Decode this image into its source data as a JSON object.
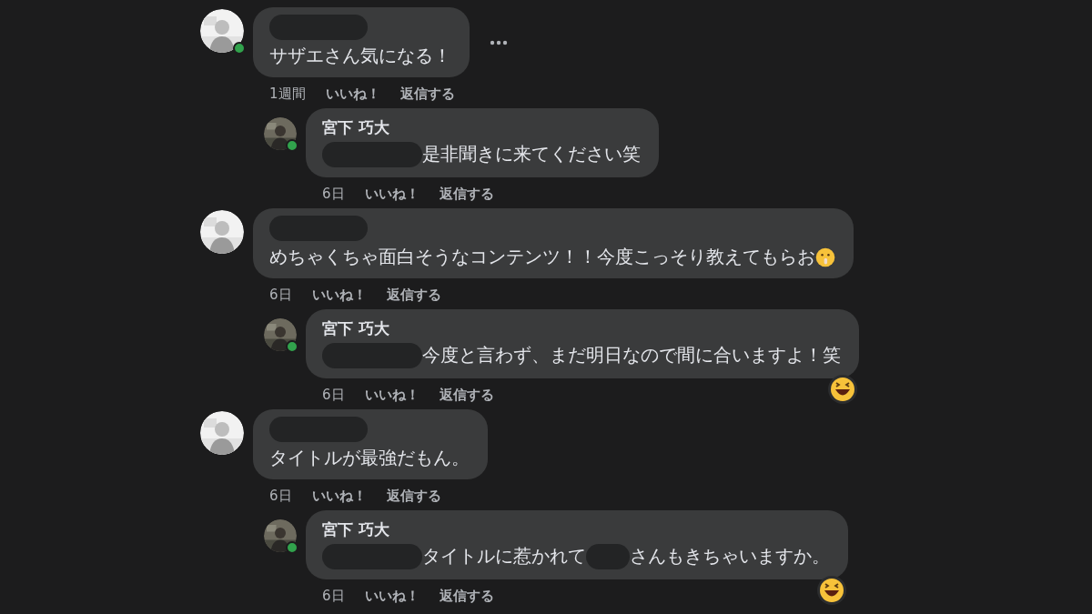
{
  "comments": [
    {
      "avatar": {
        "online": true
      },
      "author": {
        "kind": "redacted"
      },
      "message": [
        {
          "kind": "text",
          "text": "サザエさん気になる！"
        }
      ],
      "more_button": true,
      "reaction": false,
      "meta": {
        "time": "1週間",
        "like": "いいね！",
        "reply": "返信する"
      },
      "children": [
        {
          "avatar": {
            "online": true
          },
          "author": {
            "kind": "name",
            "text": "宮下 巧大"
          },
          "message": [
            {
              "kind": "redacted"
            },
            {
              "kind": "text",
              "text": "是非聞きに来てください笑"
            }
          ],
          "more_button": false,
          "reaction": false,
          "meta": {
            "time": "6日",
            "like": "いいね！",
            "reply": "返信する"
          }
        }
      ]
    },
    {
      "avatar": {
        "online": false
      },
      "author": {
        "kind": "redacted"
      },
      "message": [
        {
          "kind": "text",
          "text": "めちゃくちゃ面白そうなコンテンツ！！今度こっそり教えてもらお"
        },
        {
          "kind": "emoji"
        }
      ],
      "more_button": false,
      "reaction": false,
      "meta": {
        "time": "6日",
        "like": "いいね！",
        "reply": "返信する"
      },
      "children": [
        {
          "avatar": {
            "online": true
          },
          "author": {
            "kind": "name",
            "text": "宮下 巧大"
          },
          "message": [
            {
              "kind": "redacted"
            },
            {
              "kind": "text",
              "text": "今度と言わず、まだ明日なので間に合いますよ！笑"
            }
          ],
          "more_button": false,
          "reaction": true,
          "meta": {
            "time": "6日",
            "like": "いいね！",
            "reply": "返信する"
          }
        }
      ]
    },
    {
      "avatar": {
        "online": false
      },
      "author": {
        "kind": "redacted"
      },
      "message": [
        {
          "kind": "text",
          "text": "タイトルが最強だもん。"
        }
      ],
      "more_button": false,
      "reaction": false,
      "meta": {
        "time": "6日",
        "like": "いいね！",
        "reply": "返信する"
      },
      "children": [
        {
          "avatar": {
            "online": true
          },
          "author": {
            "kind": "name",
            "text": "宮下 巧大"
          },
          "message": [
            {
              "kind": "redacted"
            },
            {
              "kind": "text",
              "text": "タイトルに惹かれて"
            },
            {
              "kind": "redacted_short"
            },
            {
              "kind": "text",
              "text": "さんもきちゃいますか。"
            }
          ],
          "more_button": false,
          "reaction": true,
          "meta": {
            "time": "6日",
            "like": "いいね！",
            "reply": "返信する"
          }
        }
      ]
    }
  ]
}
